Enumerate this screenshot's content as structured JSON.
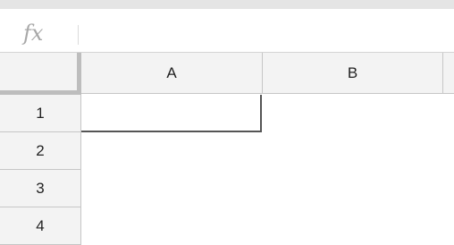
{
  "formula_bar": {
    "icon": "fx-icon",
    "fx_label": "fx",
    "value": ""
  },
  "columns": [
    "A",
    "B"
  ],
  "rows": [
    "1",
    "2",
    "3",
    "4"
  ],
  "colors": {
    "header_bg": "#f3f3f3",
    "gridline": "#c6c6c6",
    "active_border": "#555555"
  }
}
